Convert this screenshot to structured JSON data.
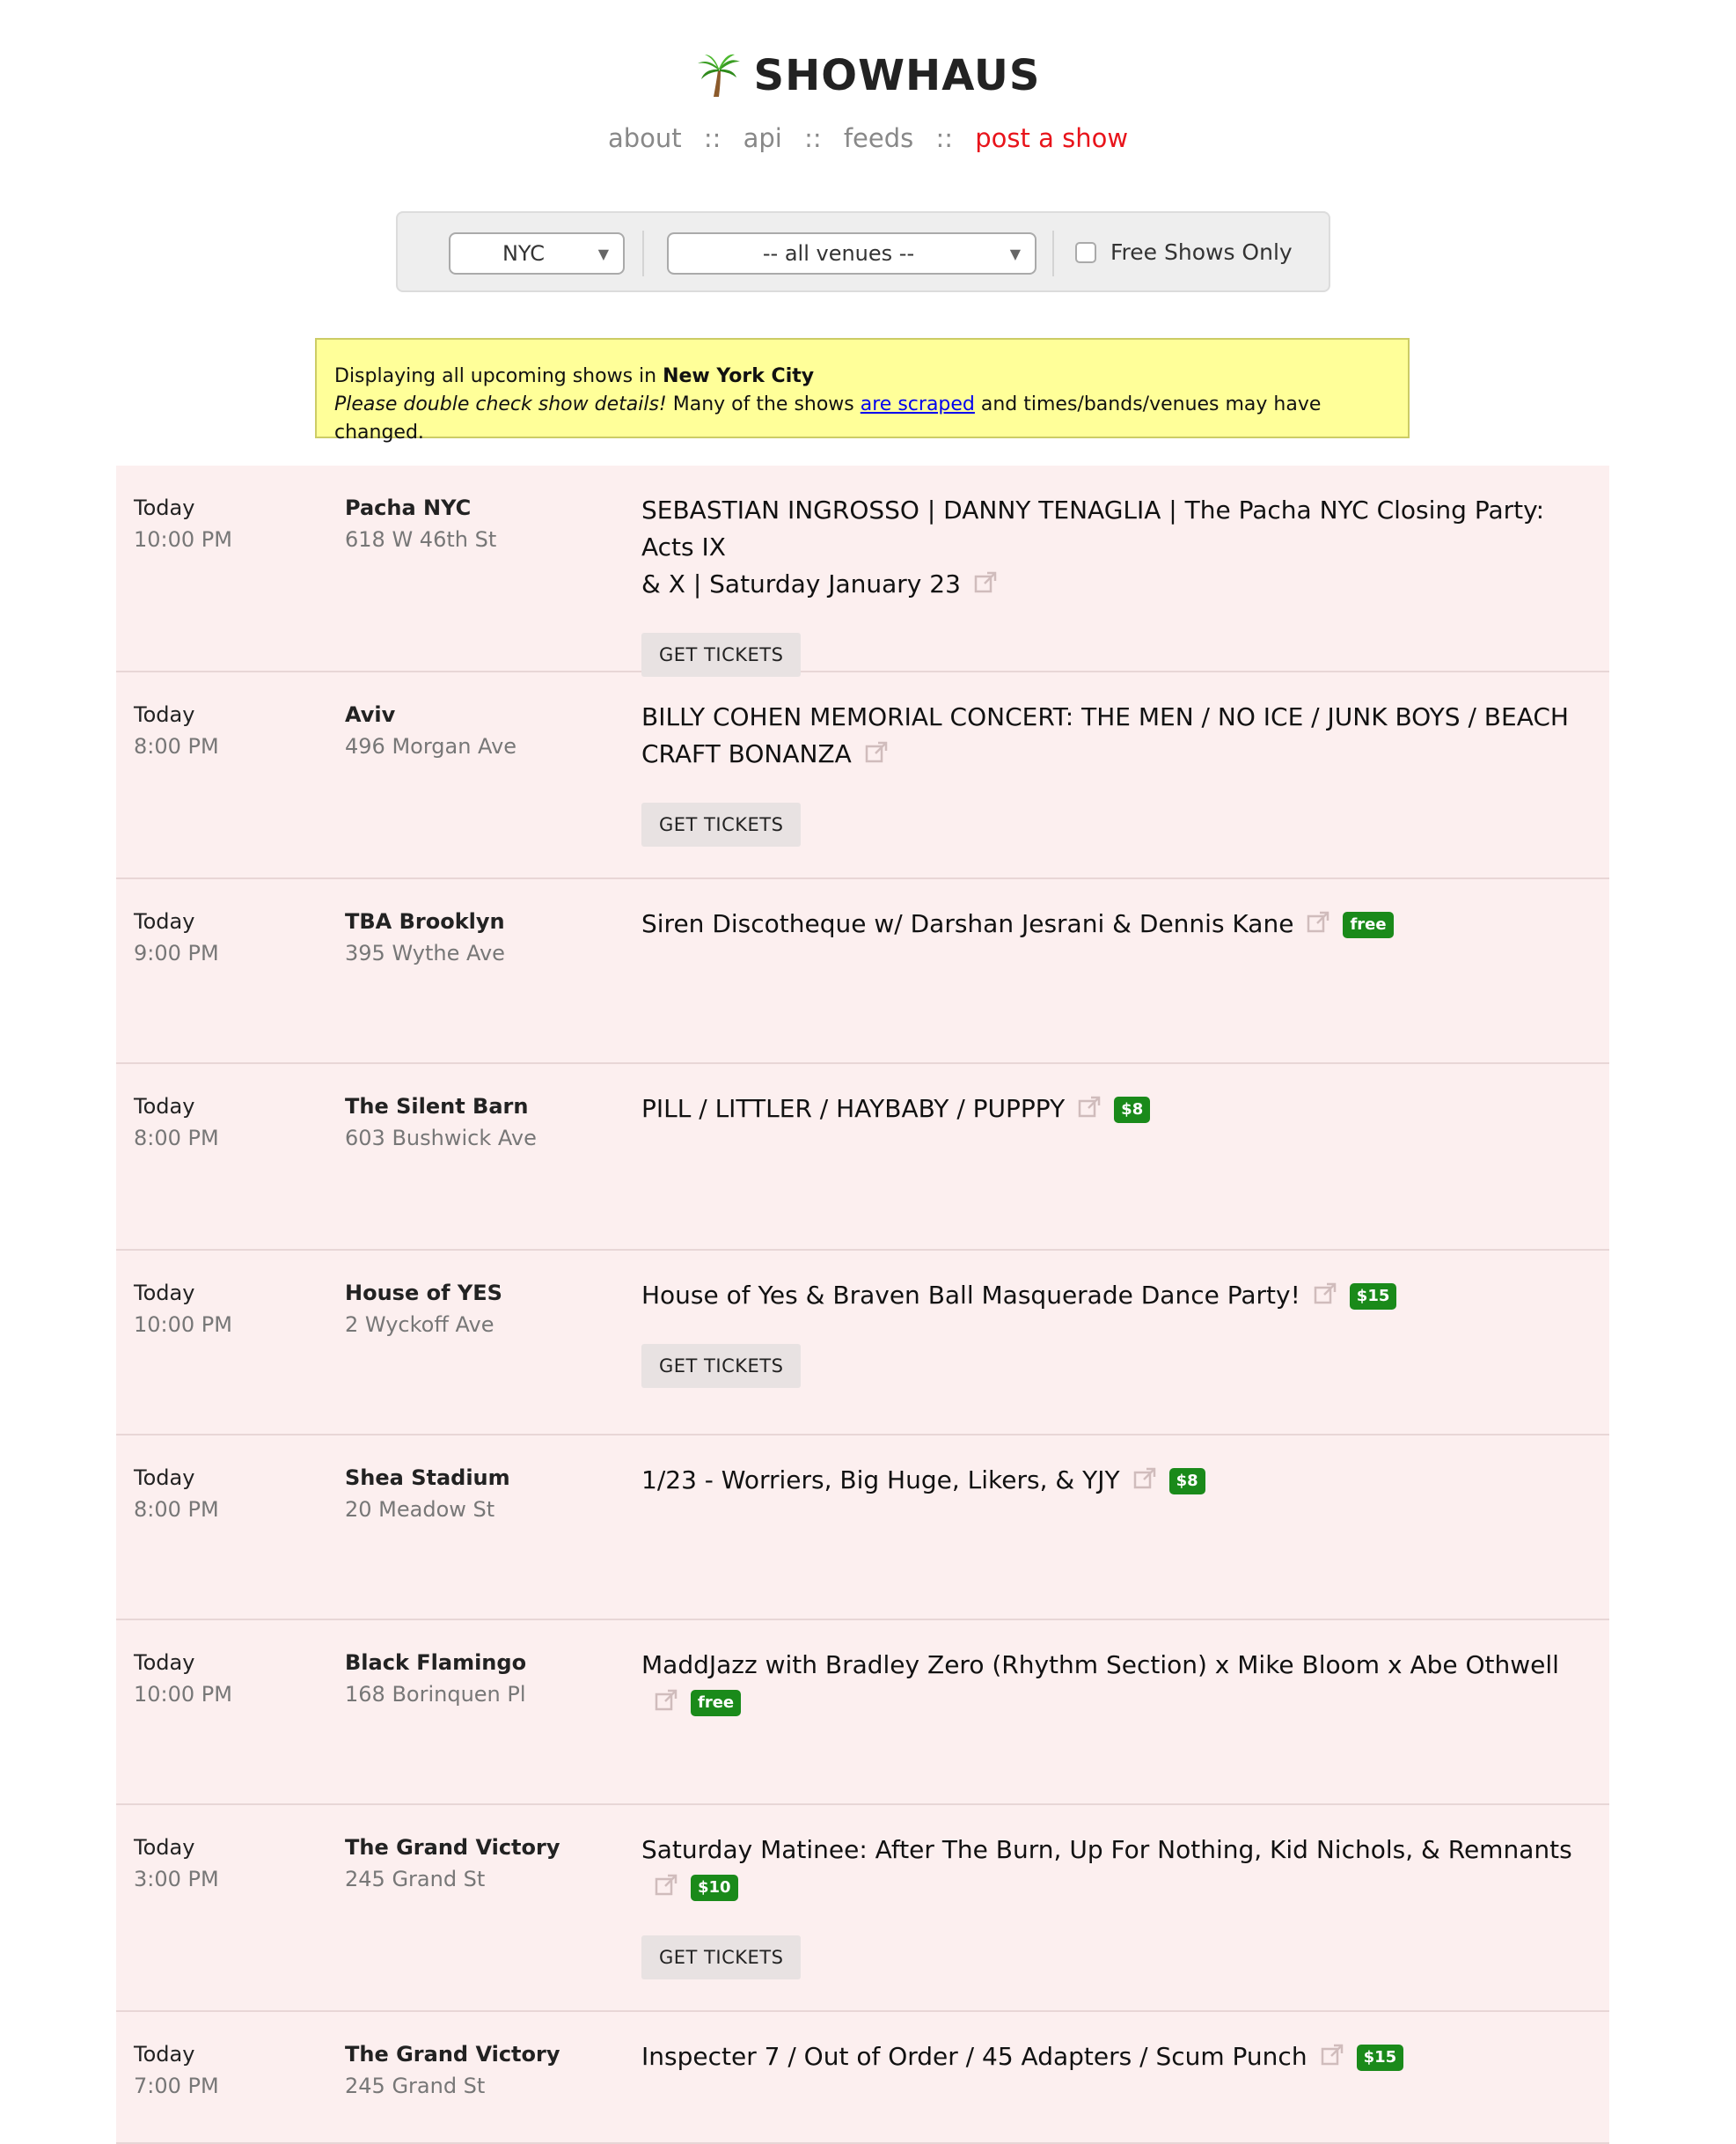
{
  "site": {
    "logo_icon": "palm-tree-icon",
    "title": "SHOWHAUS"
  },
  "nav": {
    "items": [
      {
        "label": "about"
      },
      {
        "label": "api"
      },
      {
        "label": "feeds"
      },
      {
        "label": "post a show"
      }
    ],
    "separator": "::",
    "accent_color": "#e8141b"
  },
  "filters": {
    "city": "NYC",
    "venue": "-- all venues --",
    "free_only_label": "Free Shows Only",
    "free_only_checked": false
  },
  "notice": {
    "line1_prefix": "Displaying all upcoming shows in ",
    "city": "New York City",
    "italic": "Please double check show details!",
    "middle": " Many of the shows ",
    "link": "are scraped",
    "suffix": " and times/bands/venues may have changed."
  },
  "shows": [
    {
      "day": "Today",
      "time": "10:00 PM",
      "venue": "Pacha NYC",
      "address": "618 W 46th St",
      "title_lines": [
        "SEBASTIAN INGROSSO | DANNY TENAGLIA | The Pacha NYC Closing Party: Acts IX",
        "& X | Saturday January 23"
      ],
      "price": null,
      "tickets": "GET TICKETS"
    },
    {
      "day": "Today",
      "time": "8:00 PM",
      "venue": "Aviv",
      "address": "496 Morgan Ave",
      "title_lines": [
        "BILLY COHEN MEMORIAL CONCERT: THE MEN / NO ICE / JUNK BOYS / BEACH",
        "CRAFT BONANZA"
      ],
      "price": null,
      "tickets": "GET TICKETS"
    },
    {
      "day": "Today",
      "time": "9:00 PM",
      "venue": "TBA Brooklyn",
      "address": "395 Wythe Ave",
      "title_lines": [
        "Siren Discotheque w/ Darshan Jesrani & Dennis Kane"
      ],
      "price": "free",
      "tickets": null
    },
    {
      "day": "Today",
      "time": "8:00 PM",
      "venue": "The Silent Barn",
      "address": "603 Bushwick Ave",
      "title_lines": [
        "PILL / LITTLER / HAYBABY / PUPPPY"
      ],
      "price": "$8",
      "tickets": null
    },
    {
      "day": "Today",
      "time": "10:00 PM",
      "venue": "House of YES",
      "address": "2 Wyckoff Ave",
      "title_lines": [
        "House of Yes & Braven Ball Masquerade Dance Party!"
      ],
      "price": "$15",
      "tickets": "GET TICKETS"
    },
    {
      "day": "Today",
      "time": "8:00 PM",
      "venue": "Shea Stadium",
      "address": "20 Meadow St",
      "title_lines": [
        "1/23 - Worriers, Big Huge, Likers, & YJY"
      ],
      "price": "$8",
      "tickets": null
    },
    {
      "day": "Today",
      "time": "10:00 PM",
      "venue": "Black Flamingo",
      "address": "168 Borinquen Pl",
      "title_lines": [
        "MaddJazz with Bradley Zero (Rhythm Section) x Mike Bloom x Abe Othwell"
      ],
      "price": "free",
      "tickets": null
    },
    {
      "day": "Today",
      "time": "3:00 PM",
      "venue": "The Grand Victory",
      "address": "245 Grand St",
      "title_lines": [
        "Saturday Matinee: After The Burn, Up For Nothing, Kid Nichols, & Remnants"
      ],
      "price": "$10",
      "tickets": "GET TICKETS"
    },
    {
      "day": "Today",
      "time": "7:00 PM",
      "venue": "The Grand Victory",
      "address": "245 Grand St",
      "title_lines": [
        "Inspecter 7 / Out of Order / 45 Adapters / Scum Punch"
      ],
      "price": "$15",
      "tickets": null
    }
  ],
  "colors": {
    "row_bg": "#fcefef",
    "badge_green": "#1a8a1a",
    "notice_bg": "#ffff99",
    "link_blue": "#0000ee"
  }
}
